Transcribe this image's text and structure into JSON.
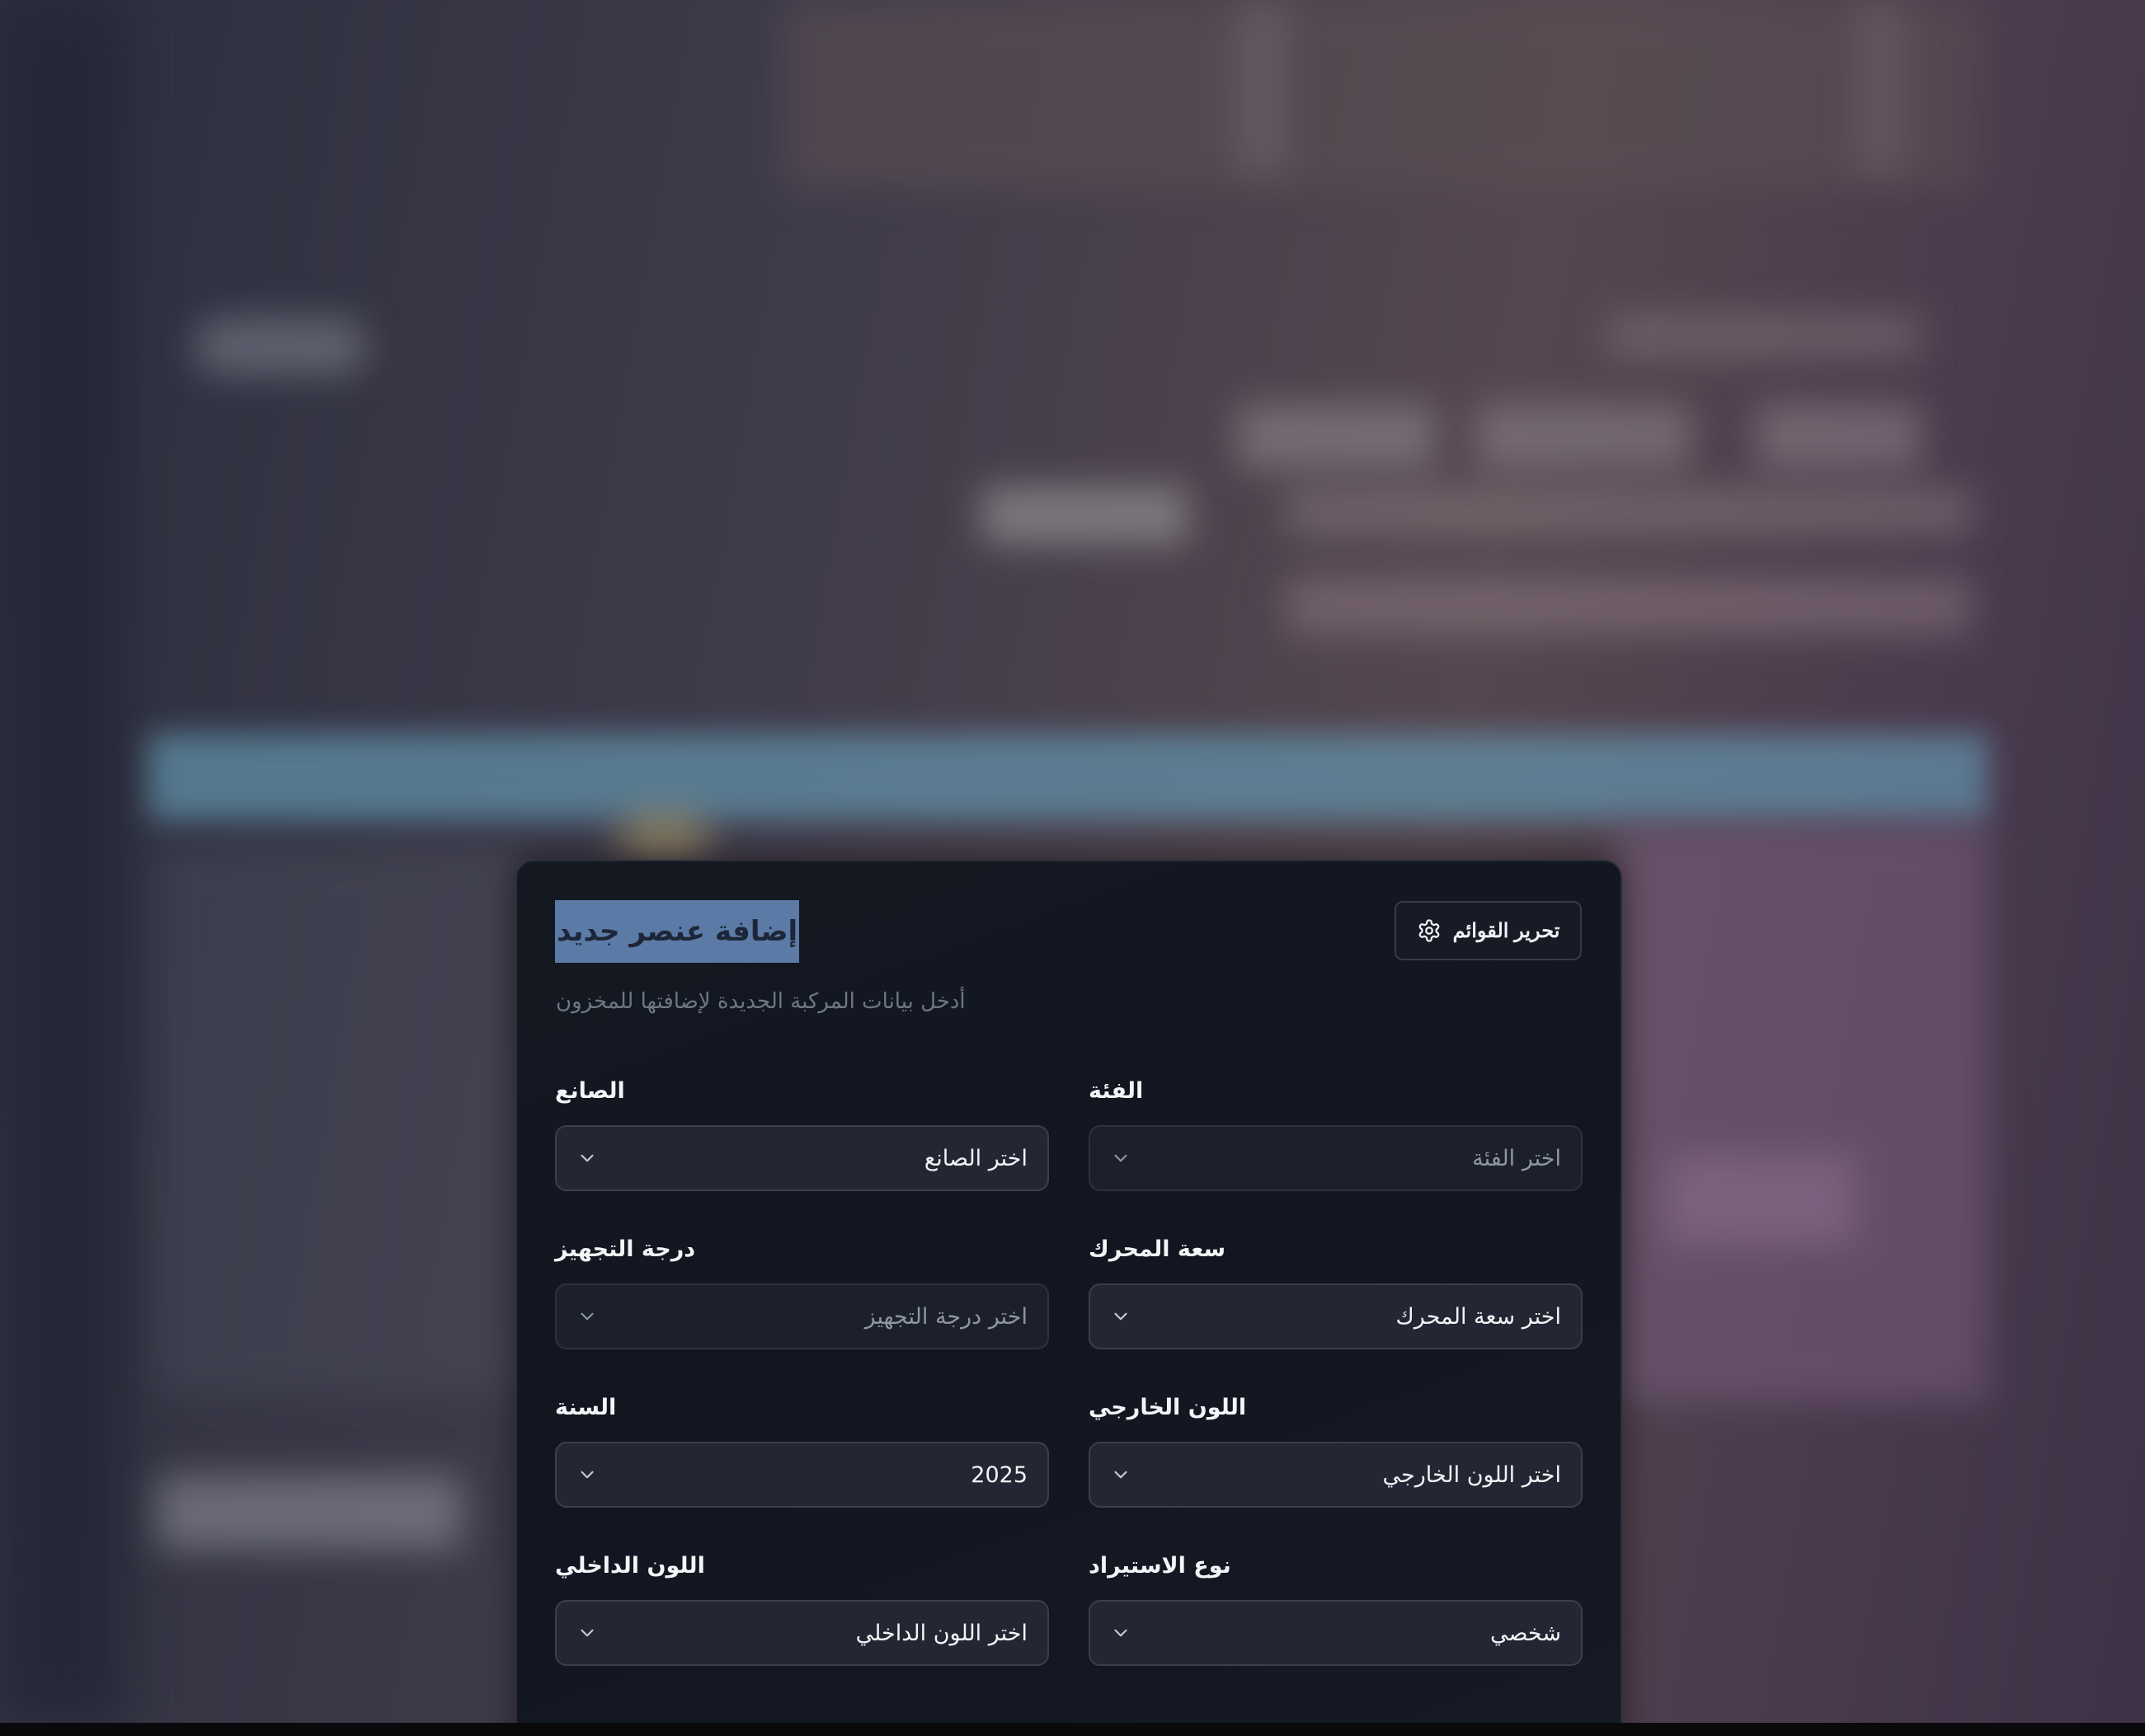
{
  "dialog": {
    "title": "إضافة عنصر جديد",
    "subtitle": "أدخل بيانات المركبة الجديدة لإضافتها للمخزون",
    "edit_lists_label": "تحرير القوائم",
    "edit_lists_icon": "gear-icon"
  },
  "fields": {
    "manufacturer": {
      "label": "الصانع",
      "value": "اختر الصانع"
    },
    "category": {
      "label": "الفئة",
      "value": "اختر الفئة"
    },
    "trim": {
      "label": "درجة التجهيز",
      "value": "اختر درجة التجهيز"
    },
    "engine": {
      "label": "سعة المحرك",
      "value": "اختر سعة المحرك"
    },
    "year": {
      "label": "السنة",
      "value": "2025"
    },
    "exterior_color": {
      "label": "اللون الخارجي",
      "value": "اختر اللون الخارجي"
    },
    "interior_color": {
      "label": "اللون الداخلي",
      "value": "اختر اللون الداخلي"
    },
    "import_type": {
      "label": "نوع الاستيراد",
      "value": "شخصي"
    }
  },
  "colors": {
    "title_highlight": "#5b7aa6",
    "dialog_bg": "#141821",
    "select_bg": "#232733"
  }
}
